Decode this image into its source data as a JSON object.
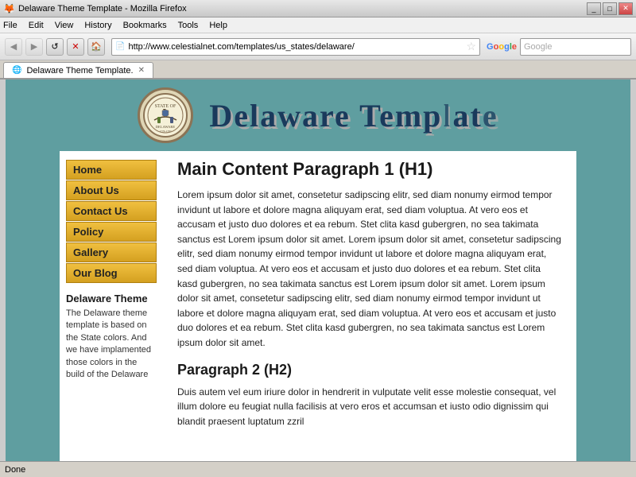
{
  "browser": {
    "title": "Delaware Theme Template - Mozilla Firefox",
    "menu_items": [
      "File",
      "Edit",
      "View",
      "History",
      "Bookmarks",
      "Tools",
      "Help"
    ],
    "address": "http://www.celestialnet.com/templates/us_states/delaware/",
    "search_placeholder": "Google",
    "tab_label": "Delaware Theme Template.",
    "status": "Done"
  },
  "header": {
    "site_title": "Delaware Template e"
  },
  "nav": {
    "items": [
      {
        "label": "Home"
      },
      {
        "label": "About Us"
      },
      {
        "label": "Contact Us"
      },
      {
        "label": "Policy"
      },
      {
        "label": "Gallery"
      },
      {
        "label": "Our Blog"
      }
    ]
  },
  "sidebar": {
    "heading": "Delaware Theme",
    "description": "The Delaware theme template is based on the State colors. And we have implamented those colors in the build of the Delaware"
  },
  "content": {
    "h1": "Main Content Paragraph 1 (H1)",
    "para1": "Lorem ipsum dolor sit amet, consetetur sadipscing elitr, sed diam nonumy eirmod tempor invidunt ut labore et dolore magna aliquyam erat, sed diam voluptua. At vero eos et accusam et justo duo dolores et ea rebum. Stet clita kasd gubergren, no sea takimata sanctus est Lorem ipsum dolor sit amet. Lorem ipsum dolor sit amet, consetetur sadipscing elitr, sed diam nonumy eirmod tempor invidunt ut labore et dolore magna aliquyam erat, sed diam voluptua. At vero eos et accusam et justo duo dolores et ea rebum. Stet clita kasd gubergren, no sea takimata sanctus est Lorem ipsum dolor sit amet. Lorem ipsum dolor sit amet, consetetur sadipscing elitr, sed diam nonumy eirmod tempor invidunt ut labore et dolore magna aliquyam erat, sed diam voluptua. At vero eos et accusam et justo duo dolores et ea rebum. Stet clita kasd gubergren, no sea takimata sanctus est Lorem ipsum dolor sit amet.",
    "h2": "Paragraph 2 (H2)",
    "para2": "Duis autem vel eum iriure dolor in hendrerit in vulputate velit esse molestie consequat, vel illum dolore eu feugiat nulla facilisis at vero eros et accumsan et iusto odio dignissim qui blandit praesent luptatum zzril"
  }
}
